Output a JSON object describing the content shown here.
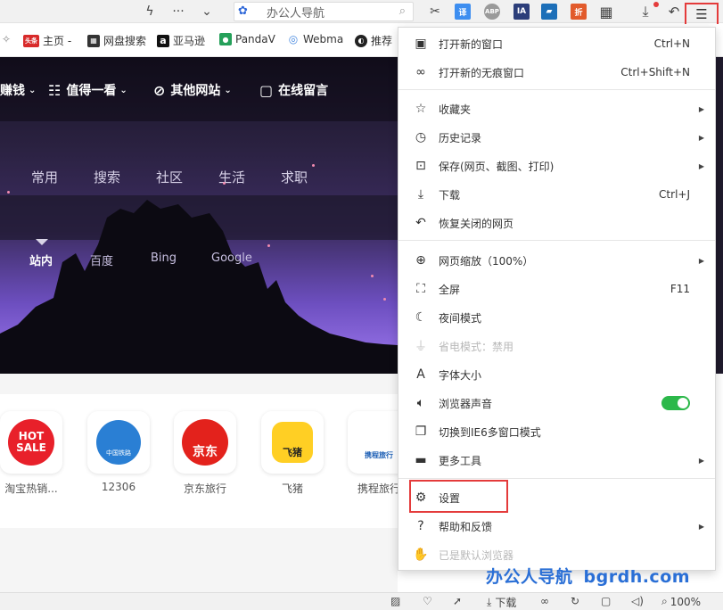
{
  "toolbar": {
    "search_text": "办公人导航",
    "extensions": [
      {
        "name": "scissors-icon",
        "label": "✂"
      },
      {
        "name": "translate-icon",
        "label": "译"
      },
      {
        "name": "adblock-icon",
        "label": "ABP"
      },
      {
        "name": "ia-icon",
        "label": "IA"
      },
      {
        "name": "book-icon",
        "label": ""
      },
      {
        "name": "discount-icon",
        "label": "折"
      }
    ]
  },
  "bookmarks": [
    {
      "label": "主页 -",
      "icon_text": "头条"
    },
    {
      "label": "网盘搜索",
      "icon_text": ""
    },
    {
      "label": "亚马逊",
      "icon_text": "a"
    },
    {
      "label": "PandaV",
      "icon_text": ""
    },
    {
      "label": "Webma",
      "icon_text": ""
    },
    {
      "label": "推荐",
      "icon_text": ""
    }
  ],
  "hero": {
    "nav": [
      {
        "label": "赚钱"
      },
      {
        "label": "值得一看"
      },
      {
        "label": "其他网站"
      },
      {
        "label": "在线留言"
      }
    ],
    "categories": [
      "常用",
      "搜索",
      "社区",
      "生活",
      "求职"
    ],
    "engines": [
      "站内",
      "百度",
      "Bing",
      "Google"
    ]
  },
  "tiles": [
    {
      "label": "淘宝热销...",
      "art": "HOT SALE"
    },
    {
      "label": "12306",
      "art": "中国铁路"
    },
    {
      "label": "京东旅行",
      "art": "京东"
    },
    {
      "label": "飞猪",
      "art": "飞猪"
    },
    {
      "label": "携程旅行",
      "art": "携程旅行"
    }
  ],
  "menu": {
    "groups": [
      [
        {
          "label": "打开新的窗口",
          "shortcut": "Ctrl+N",
          "icon": "new-window-icon",
          "arrow": false
        },
        {
          "label": "打开新的无痕窗口",
          "shortcut": "Ctrl+Shift+N",
          "icon": "incognito-icon",
          "arrow": false
        }
      ],
      [
        {
          "label": "收藏夹",
          "shortcut": "",
          "icon": "favorites-icon",
          "arrow": true
        },
        {
          "label": "历史记录",
          "shortcut": "",
          "icon": "history-icon",
          "arrow": true
        },
        {
          "label": "保存(网页、截图、打印)",
          "shortcut": "",
          "icon": "save-icon",
          "arrow": true
        },
        {
          "label": "下载",
          "shortcut": "Ctrl+J",
          "icon": "download-icon",
          "arrow": false
        },
        {
          "label": "恢复关闭的网页",
          "shortcut": "",
          "icon": "restore-icon",
          "arrow": false
        }
      ],
      [
        {
          "label": "网页缩放（100%）",
          "shortcut": "",
          "icon": "zoom-icon",
          "arrow": true
        },
        {
          "label": "全屏",
          "shortcut": "F11",
          "icon": "fullscreen-icon",
          "arrow": false
        },
        {
          "label": "夜间模式",
          "shortcut": "",
          "icon": "night-mode-icon",
          "arrow": false
        },
        {
          "label": "省电模式：禁用",
          "shortcut": "",
          "icon": "power-save-icon",
          "arrow": false,
          "disabled": true
        },
        {
          "label": "字体大小",
          "shortcut": "",
          "icon": "font-size-icon",
          "arrow": false
        },
        {
          "label": "浏览器声音",
          "shortcut": "",
          "icon": "sound-icon",
          "arrow": false,
          "toggle": true
        },
        {
          "label": "切换到IE6多窗口模式",
          "shortcut": "",
          "icon": "ie6-mode-icon",
          "arrow": false
        },
        {
          "label": "更多工具",
          "shortcut": "",
          "icon": "toolbox-icon",
          "arrow": true
        }
      ],
      [
        {
          "label": "设置",
          "shortcut": "",
          "icon": "settings-icon",
          "arrow": false
        },
        {
          "label": "帮助和反馈",
          "shortcut": "",
          "icon": "help-icon",
          "arrow": true
        },
        {
          "label": "已是默认浏览器",
          "shortcut": "",
          "icon": "thumbs-up-icon",
          "arrow": false,
          "disabled": true
        }
      ]
    ],
    "toggle_color": "#2cb84a",
    "highlight_color": "#e43b3b"
  },
  "watermark": {
    "cn": "办公人导航",
    "en": "bgrdh.com"
  },
  "statusbar": {
    "download_label": "下载",
    "zoom": "100%"
  }
}
